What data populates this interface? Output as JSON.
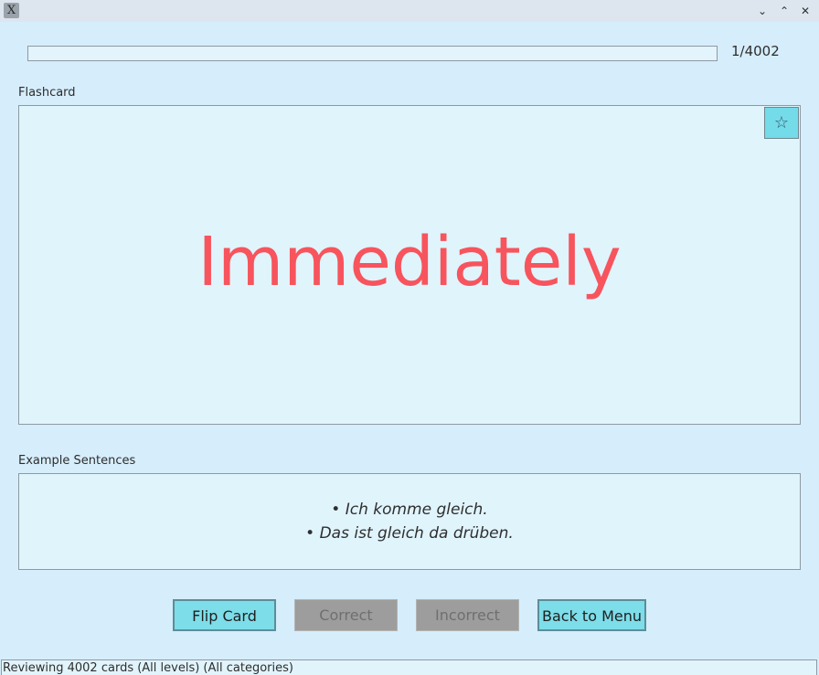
{
  "window": {
    "app_icon": "x-letter-icon",
    "controls": [
      "minimize-chevron-icon",
      "maximize-chevron-icon",
      "close-icon"
    ]
  },
  "progress": {
    "counter": "1/4002",
    "fraction": 0
  },
  "flashcard": {
    "label": "Flashcard",
    "word": "Immediately",
    "word_color": "#f7545d",
    "favorite_icon": "star-icon",
    "favorite_glyph": "☆"
  },
  "examples": {
    "label": "Example Sentences",
    "sentences": [
      "• Ich komme gleich.",
      "• Das ist gleich da drüben."
    ]
  },
  "buttons": {
    "flip": "Flip Card",
    "correct": "Correct",
    "incorrect": "Incorrect",
    "back": "Back to Menu"
  },
  "status": {
    "text": "Reviewing 4002 cards (All levels) (All categories)"
  },
  "colors": {
    "background": "#d6edfb",
    "accent_button": "#7ddde9",
    "disabled_button": "#9d9d9d"
  }
}
